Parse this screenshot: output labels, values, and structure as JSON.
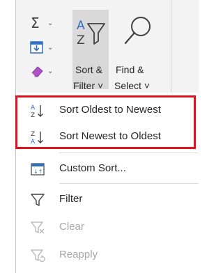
{
  "ribbon": {
    "sort_filter": {
      "label_line1": "Sort &",
      "label_line2": "Filter ˅"
    },
    "find_select": {
      "label_line1": "Find &",
      "label_line2": "Select ˅"
    }
  },
  "menu": {
    "items": [
      {
        "label": "Sort Oldest to Newest",
        "icon": "sort-ascending-icon",
        "enabled": true
      },
      {
        "label": "Sort Newest to Oldest",
        "icon": "sort-descending-icon",
        "enabled": true
      },
      {
        "label": "Custom Sort...",
        "icon": "custom-sort-icon",
        "enabled": true
      },
      {
        "label": "Filter",
        "icon": "filter-icon",
        "enabled": true
      },
      {
        "label": "Clear",
        "icon": "clear-filter-icon",
        "enabled": false
      },
      {
        "label": "Reapply",
        "icon": "reapply-filter-icon",
        "enabled": false
      }
    ]
  },
  "colors": {
    "highlight_border": "#e0141e",
    "accent_blue": "#2f6fc4",
    "eraser_purple": "#b14fc5",
    "disabled_text": "#a6a6a6"
  }
}
